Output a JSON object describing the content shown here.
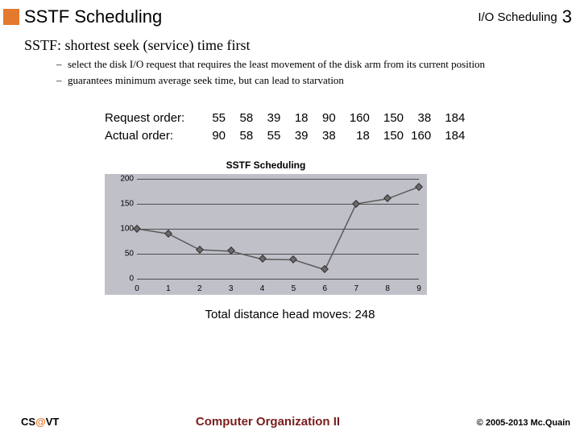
{
  "header": {
    "title": "SSTF Scheduling",
    "topic": "I/O Scheduling",
    "page_num": "3"
  },
  "subtitle": "SSTF: shortest seek (service) time first",
  "bullets": [
    "select the disk I/O request that requires the least movement of the disk arm from its current position",
    "guarantees minimum average seek time, but can lead to starvation"
  ],
  "orders": {
    "request_label": "Request order:",
    "actual_label": "Actual order:",
    "request": [
      "55",
      "58",
      "39",
      "18",
      "90",
      "160",
      "150",
      "38",
      "184"
    ],
    "actual": [
      "90",
      "58",
      "55",
      "39",
      "38",
      "18",
      "150",
      "160",
      "184"
    ]
  },
  "total_line": "Total distance head moves:  248",
  "footer": {
    "org_pre": "CS",
    "org_at": "@",
    "org_post": "VT",
    "course": "Computer Organization II",
    "copyright": "© 2005-2013 Mc.Quain"
  },
  "chart_data": {
    "type": "line",
    "title": "SSTF Scheduling",
    "xlabel": "",
    "ylabel": "",
    "categories": [
      "0",
      "1",
      "2",
      "3",
      "4",
      "5",
      "6",
      "7",
      "8",
      "9"
    ],
    "x": [
      0,
      1,
      2,
      3,
      4,
      5,
      6,
      7,
      8,
      9
    ],
    "values": [
      100,
      90,
      58,
      55,
      39,
      38,
      18,
      150,
      160,
      184
    ],
    "ylim": [
      0,
      200
    ],
    "yticks": [
      0,
      50,
      100,
      150,
      200
    ]
  }
}
